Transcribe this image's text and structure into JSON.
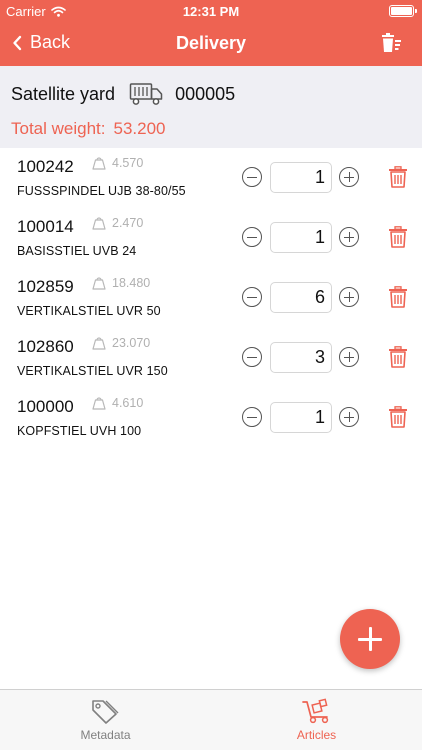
{
  "status_bar": {
    "carrier": "Carrier",
    "time": "12:31 PM"
  },
  "nav": {
    "back_label": "Back",
    "title": "Delivery",
    "action_icon": "delete-all-icon"
  },
  "summary": {
    "yard": "Satellite yard",
    "delivery_number": "000005",
    "total_weight_label": "Total weight:",
    "total_weight_value": "53.200"
  },
  "articles": [
    {
      "number": "100242",
      "weight": "4.570",
      "name": "FUSSSPINDEL UJB 38-80/55",
      "quantity": "1"
    },
    {
      "number": "100014",
      "weight": "2.470",
      "name": "BASISSTIEL UVB 24",
      "quantity": "1"
    },
    {
      "number": "102859",
      "weight": "18.480",
      "name": "VERTIKALSTIEL UVR  50",
      "quantity": "6"
    },
    {
      "number": "102860",
      "weight": "23.070",
      "name": "VERTIKALSTIEL UVR 150",
      "quantity": "3"
    },
    {
      "number": "100000",
      "weight": "4.610",
      "name": "KOPFSTIEL UVH 100",
      "quantity": "1"
    }
  ],
  "tabs": [
    {
      "label": "Metadata",
      "icon": "tag-icon",
      "active": false
    },
    {
      "label": "Articles",
      "icon": "hand-truck-icon",
      "active": true
    }
  ],
  "colors": {
    "accent": "#ee6352",
    "header_bg": "#efeff4",
    "tab_inactive": "#808080"
  }
}
